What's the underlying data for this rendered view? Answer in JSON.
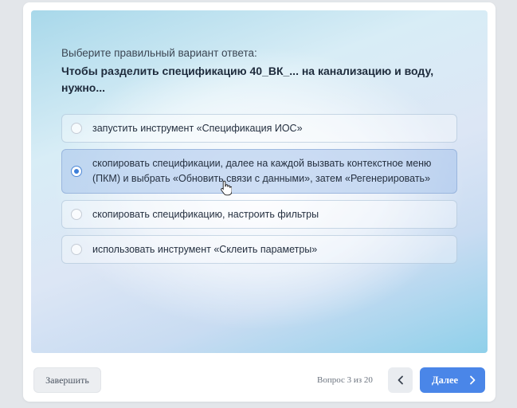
{
  "quiz": {
    "instruction": "Выберите правильный вариант ответа:",
    "question": "Чтобы разделить спецификацию 40_ВК_... на канализацию и воду, нужно...",
    "options": [
      {
        "label": "запустить инструмент «Спецификация ИОС»",
        "selected": false
      },
      {
        "label": "скопировать спецификации, далее на каждой вызвать контекстное меню (ПКМ) и выбрать «Обновить связи с данными», затем «Регенерировать»",
        "selected": true
      },
      {
        "label": "скопировать спецификацию, настроить фильтры",
        "selected": false
      },
      {
        "label": "использовать инструмент «Склеить параметры»",
        "selected": false
      }
    ]
  },
  "footer": {
    "finish_label": "Завершить",
    "progress_text": "Вопрос 3 из 20",
    "prev_icon": "chevron-left-icon",
    "next_label": "Далее",
    "next_icon": "chevron-right-icon"
  },
  "colors": {
    "accent": "#4a86e8",
    "selected_radio": "#3d7fd9",
    "question_text": "#1e2b3c"
  }
}
